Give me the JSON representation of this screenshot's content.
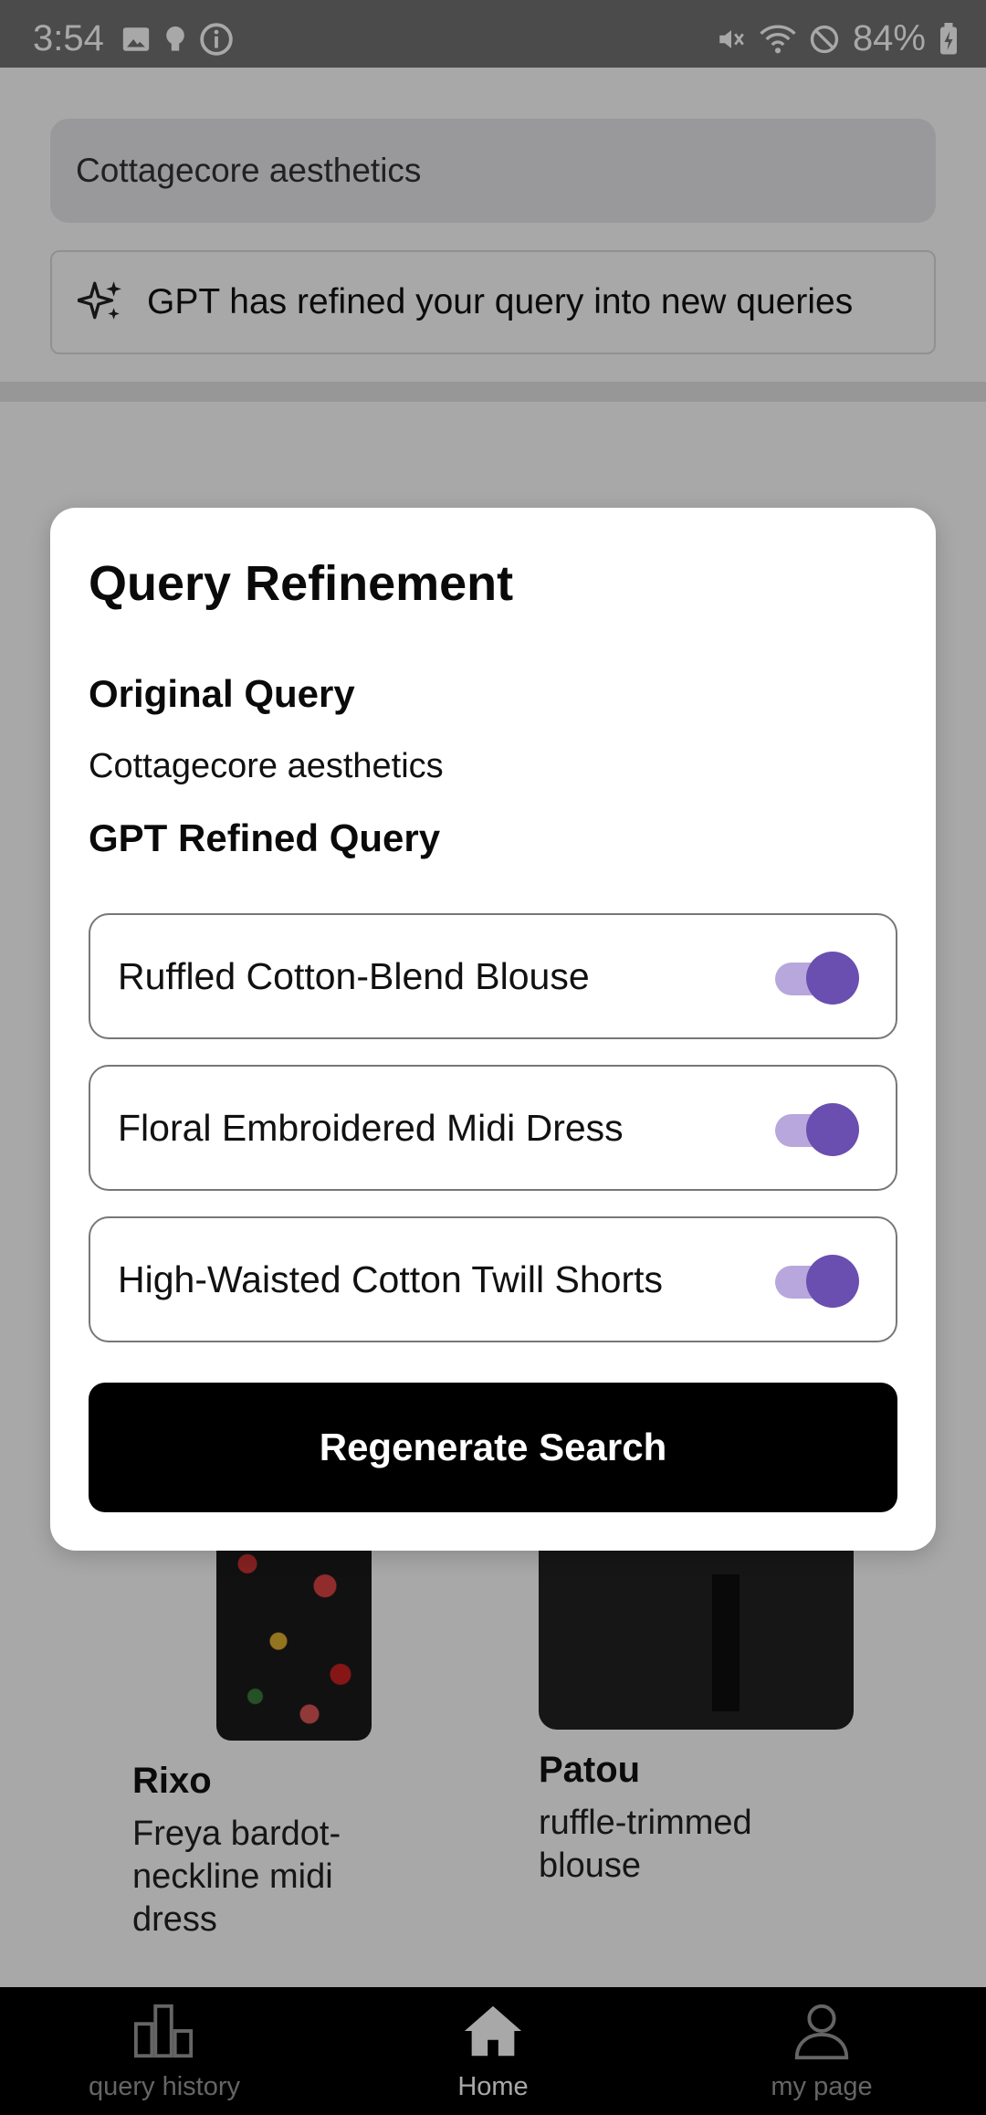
{
  "status_bar": {
    "time": "3:54",
    "battery": "84%",
    "left_icons": [
      "image-icon",
      "lightbulb-icon",
      "info-icon"
    ],
    "right_icons": [
      "mute-icon",
      "wifi-icon",
      "do-not-disturb-icon",
      "battery-charging-icon"
    ]
  },
  "page": {
    "search_value": "Cottagecore aesthetics",
    "banner_text": "GPT has refined your query into new queries",
    "products": [
      {
        "brand": "Rixo",
        "description": "Freya bardot-neckline midi dress"
      },
      {
        "brand": "Patou",
        "description": "ruffle-trimmed blouse"
      }
    ]
  },
  "dialog": {
    "title": "Query Refinement",
    "original_label": "Original Query",
    "original_value": "Cottagecore aesthetics",
    "refined_label": "GPT Refined Query",
    "refined_queries": [
      {
        "label": "Ruffled Cotton-Blend Blouse",
        "enabled": true
      },
      {
        "label": "Floral Embroidered Midi Dress",
        "enabled": true
      },
      {
        "label": "High-Waisted Cotton Twill Shorts",
        "enabled": true
      }
    ],
    "button_label": "Regenerate Search"
  },
  "bottom_nav": {
    "items": [
      {
        "label": "query history",
        "icon": "bar-chart-icon",
        "active": false
      },
      {
        "label": "Home",
        "icon": "home-icon",
        "active": true
      },
      {
        "label": "my page",
        "icon": "person-icon",
        "active": false
      }
    ]
  },
  "colors": {
    "accent": "#6a4eb0",
    "accent_track": "#b8a7dc",
    "button": "#000000"
  }
}
